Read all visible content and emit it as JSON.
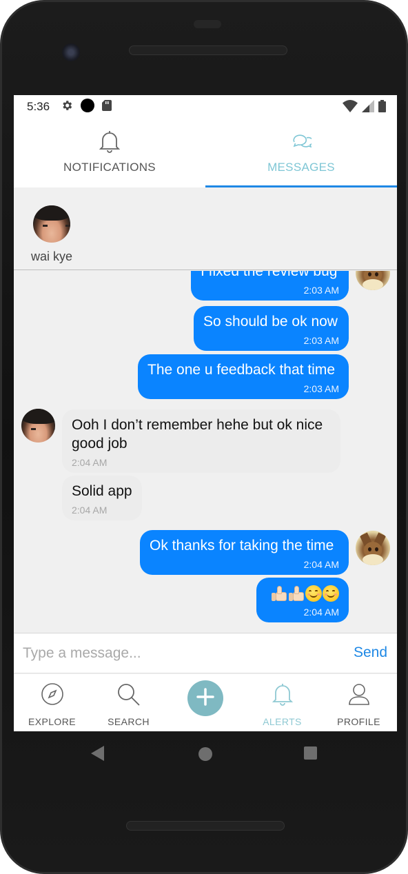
{
  "status_bar": {
    "time": "5:36",
    "icons_left": [
      "gear-icon",
      "record-dot-icon",
      "sd-card-icon"
    ],
    "icons_right": [
      "wifi-icon",
      "signal-icon",
      "battery-icon"
    ]
  },
  "top_tabs": [
    {
      "label": "NOTIFICATIONS",
      "icon": "bell-icon",
      "active": false
    },
    {
      "label": "MESSAGES",
      "icon": "chat-bubbles-icon",
      "active": true
    }
  ],
  "contacts": [
    {
      "name": "wai kye",
      "avatar": "avatar-photo"
    }
  ],
  "messages": [
    {
      "direction": "out",
      "text": "I fixed the review bug",
      "time": "2:03 AM"
    },
    {
      "direction": "out",
      "text": "So should be ok now",
      "time": "2:03 AM"
    },
    {
      "direction": "out",
      "text": "The one u feedback that time",
      "time": "2:03 AM"
    },
    {
      "direction": "in",
      "text": "Ooh I don’t remember hehe but ok nice good job",
      "time": "2:04 AM"
    },
    {
      "direction": "in",
      "text": "Solid app",
      "time": "2:04 AM"
    },
    {
      "direction": "out",
      "text": "Ok thanks for taking the time",
      "time": "2:04 AM"
    },
    {
      "direction": "out",
      "text": "👍🏻👍🏻😊😊",
      "time": "2:04 AM"
    }
  ],
  "composer": {
    "placeholder": "Type a message...",
    "send_label": "Send"
  },
  "bottom_nav": [
    {
      "label": "EXPLORE",
      "icon": "compass-icon",
      "active": false
    },
    {
      "label": "SEARCH",
      "icon": "search-icon",
      "active": false
    },
    {
      "label": "",
      "icon": "plus-icon",
      "active": false
    },
    {
      "label": "ALERTS",
      "icon": "bell-icon",
      "active": true
    },
    {
      "label": "PROFILE",
      "icon": "user-icon",
      "active": false
    }
  ],
  "colors": {
    "accent_blue": "#1e88e5",
    "outgoing_bubble": "#0a84ff",
    "incoming_bubble": "#ececec",
    "teal_active": "#7ec6d5",
    "add_button": "#7fb9c2"
  }
}
